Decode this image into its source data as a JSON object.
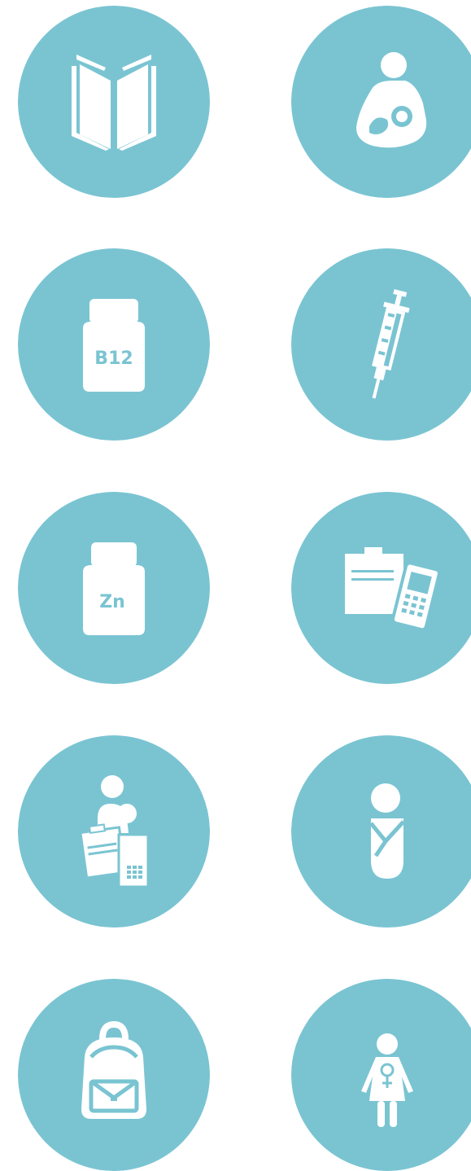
{
  "colors": {
    "circle": "#7ac4d2",
    "icon": "#ffffff"
  },
  "icons": [
    {
      "id": "book",
      "name": "open-book-icon"
    },
    {
      "id": "breastfeeding",
      "name": "breastfeeding-mother-icon"
    },
    {
      "id": "b12",
      "name": "vitamin-b12-bottle-icon",
      "label": "B12"
    },
    {
      "id": "syringe",
      "name": "syringe-icon"
    },
    {
      "id": "zinc",
      "name": "zinc-supplement-bottle-icon",
      "label": "Zn"
    },
    {
      "id": "clipboard-phone",
      "name": "clipboard-phone-icon"
    },
    {
      "id": "mother-records",
      "name": "mother-with-records-icon"
    },
    {
      "id": "swaddled-baby",
      "name": "swaddled-baby-icon"
    },
    {
      "id": "schoolbag",
      "name": "schoolbag-icon"
    },
    {
      "id": "girl-female",
      "name": "girl-female-symbol-icon"
    }
  ]
}
